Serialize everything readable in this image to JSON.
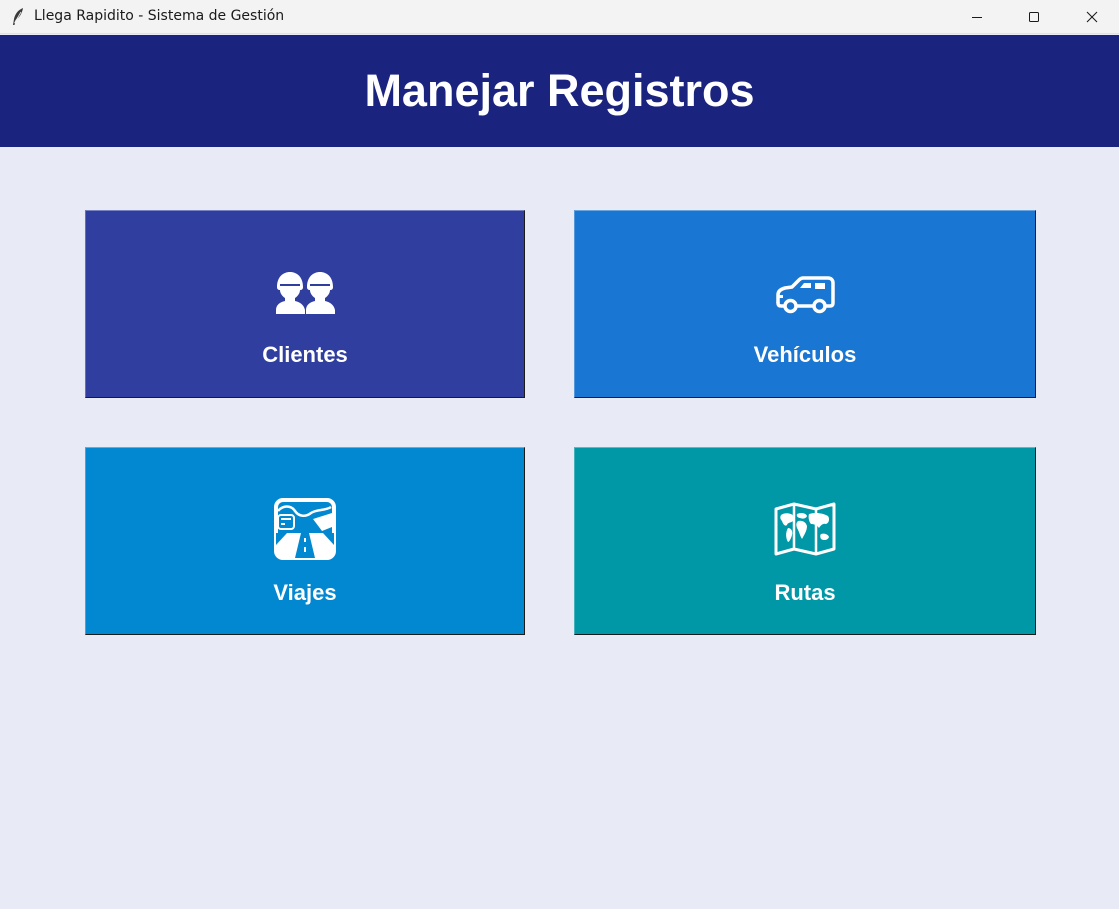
{
  "window": {
    "title": "Llega Rapidito - Sistema de Gestión",
    "icon": "feather-icon",
    "controls": [
      "minimize-icon",
      "maximize-icon",
      "close-icon"
    ]
  },
  "header": {
    "title": "Manejar Registros",
    "background": "#1a237e"
  },
  "background": "#e8eaf6",
  "tiles": [
    {
      "label": "Clientes",
      "icon": "users-icon",
      "color": "#303f9f"
    },
    {
      "label": "Vehículos",
      "icon": "car-icon",
      "color": "#1976d2"
    },
    {
      "label": "Viajes",
      "icon": "road-trip-icon",
      "color": "#0288d1"
    },
    {
      "label": "Rutas",
      "icon": "world-map-icon",
      "color": "#0097a7"
    }
  ]
}
